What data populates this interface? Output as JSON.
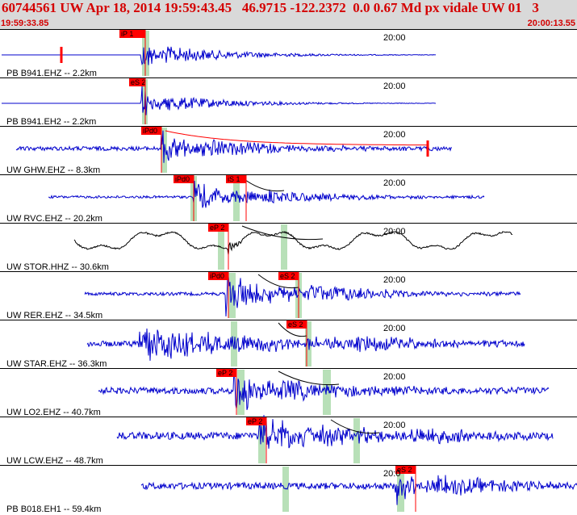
{
  "header": {
    "title": "60744561 UW Apr 18, 2014 19:59:43.45   46.9715 -122.2372  0.0 0.67 Md px vidale UW 01   3",
    "start_time": "19:59:33.85",
    "end_time": "20:00:13.55"
  },
  "colors": {
    "header_bg": "#d9d9d9",
    "header_text": "#d40000",
    "trace_blue": "#0000cc",
    "trace_black": "#000000",
    "pick_red": "#ff0000",
    "window_green": "#b8e0b8"
  },
  "traces": [
    {
      "label": "PB B941.EHZ -- 2.2km",
      "tick": "20:00",
      "color": "blue",
      "picks": [
        {
          "name": "iP 1"
        }
      ],
      "coda": true
    },
    {
      "label": "PB B941.EH2 -- 2.2km",
      "tick": "20:00",
      "color": "blue",
      "picks": [
        {
          "name": "eS 2"
        }
      ],
      "coda": false
    },
    {
      "label": "UW GHW.EHZ -- 8.3km",
      "tick": "20:00",
      "color": "blue",
      "picks": [
        {
          "name": "iPd0"
        }
      ],
      "coda": true
    },
    {
      "label": "UW RVC.EHZ -- 20.2km",
      "tick": "20:00",
      "color": "blue",
      "picks": [
        {
          "name": "iPd0"
        },
        {
          "name": "iS 1"
        }
      ],
      "coda": false
    },
    {
      "label": "UW STOR.HHZ -- 30.6km",
      "tick": "20:00",
      "color": "black",
      "picks": [
        {
          "name": "eP 2"
        }
      ],
      "coda": false
    },
    {
      "label": "UW RER.EHZ -- 34.5km",
      "tick": "20:00",
      "color": "blue",
      "picks": [
        {
          "name": "iPd0"
        },
        {
          "name": "eS 2"
        }
      ],
      "coda": false
    },
    {
      "label": "UW STAR.EHZ -- 36.3km",
      "tick": "20:00",
      "color": "blue",
      "picks": [
        {
          "name": "eS 2"
        }
      ],
      "coda": false
    },
    {
      "label": "UW LO2.EHZ -- 40.7km",
      "tick": "20:00",
      "color": "blue",
      "picks": [
        {
          "name": "eP 2"
        }
      ],
      "coda": false
    },
    {
      "label": "UW LCW.EHZ -- 48.7km",
      "tick": "20:00",
      "color": "blue",
      "picks": [
        {
          "name": "eP 2"
        }
      ],
      "coda": false
    },
    {
      "label": "PB B018.EH1 -- 59.4km",
      "tick": "20:0",
      "color": "blue",
      "picks": [
        {
          "name": "eS 2"
        }
      ],
      "coda": false
    }
  ]
}
